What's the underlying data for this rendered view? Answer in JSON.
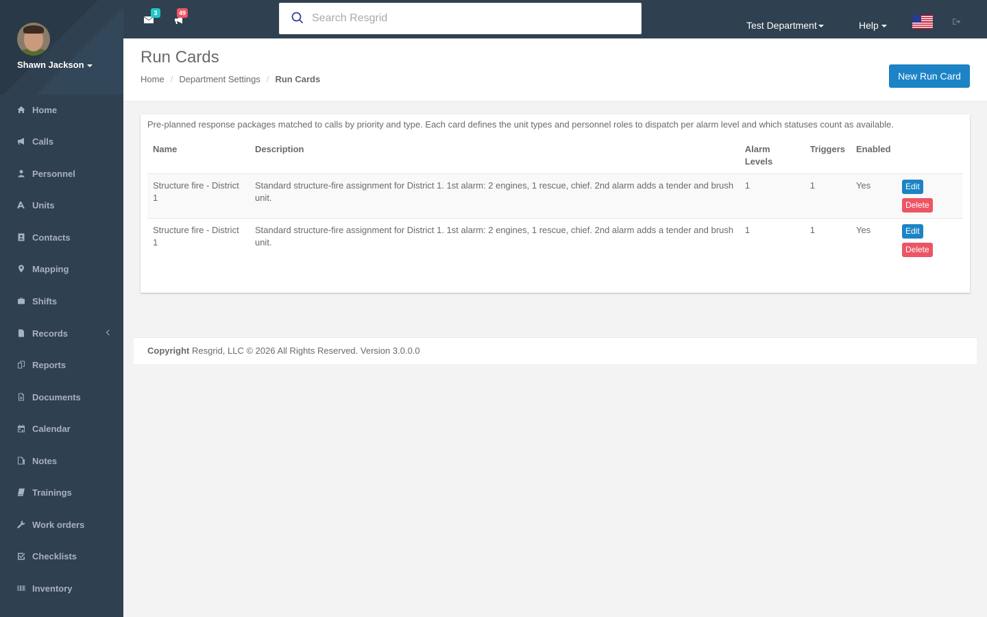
{
  "user": {
    "name": "Shawn Jackson"
  },
  "sidebar": {
    "items": [
      {
        "label": "Home",
        "icon": "home-icon"
      },
      {
        "label": "Calls",
        "icon": "bullhorn-icon"
      },
      {
        "label": "Personnel",
        "icon": "user-icon"
      },
      {
        "label": "Units",
        "icon": "truck-icon"
      },
      {
        "label": "Contacts",
        "icon": "address-book-icon"
      },
      {
        "label": "Mapping",
        "icon": "map-marker-icon"
      },
      {
        "label": "Shifts",
        "icon": "briefcase-icon"
      },
      {
        "label": "Records",
        "icon": "file-icon"
      },
      {
        "label": "Reports",
        "icon": "copy-icon"
      },
      {
        "label": "Documents",
        "icon": "document-icon"
      },
      {
        "label": "Calendar",
        "icon": "calendar-icon"
      },
      {
        "label": "Notes",
        "icon": "notes-icon"
      },
      {
        "label": "Trainings",
        "icon": "book-icon"
      },
      {
        "label": "Work orders",
        "icon": "wrench-icon"
      },
      {
        "label": "Checklists",
        "icon": "check-square-icon"
      },
      {
        "label": "Inventory",
        "icon": "barcode-icon"
      }
    ]
  },
  "topbar": {
    "messages_count": "3",
    "calls_count": "49",
    "search_placeholder": "Search Resgrid",
    "department": "Test Department",
    "help": "Help"
  },
  "page": {
    "title": "Run Cards",
    "breadcrumb": [
      "Home",
      "Department Settings",
      "Run Cards"
    ],
    "new_button": "New Run Card",
    "intro": "Pre-planned response packages matched to calls by priority and type. Each card defines the unit types and personnel roles to dispatch per alarm level and which statuses count as available."
  },
  "table": {
    "headers": [
      "Name",
      "Description",
      "Alarm Levels",
      "Triggers",
      "Enabled"
    ],
    "rows": [
      {
        "name": "Structure fire - District 1",
        "description": "Standard structure-fire assignment for District 1. 1st alarm: 2 engines, 1 rescue, chief. 2nd alarm adds a tender and brush unit.",
        "alarm_levels": "1",
        "triggers": "1",
        "enabled": "Yes",
        "edit": "Edit",
        "delete": "Delete"
      },
      {
        "name": "Structure fire - District 1",
        "description": "Standard structure-fire assignment for District 1. 1st alarm: 2 engines, 1 rescue, chief. 2nd alarm adds a tender and brush unit.",
        "alarm_levels": "1",
        "triggers": "1",
        "enabled": "Yes",
        "edit": "Edit",
        "delete": "Delete"
      }
    ]
  },
  "footer": {
    "copyright_label": "Copyright",
    "copyright_text": "Resgrid, LLC © 2026 All Rights Reserved.",
    "version": "Version 3.0.0.0"
  },
  "colors": {
    "sidebar_bg": "#2f4050",
    "primary": "#1c84c6",
    "danger": "#ed5565",
    "badge_teal": "#23c6c8"
  }
}
